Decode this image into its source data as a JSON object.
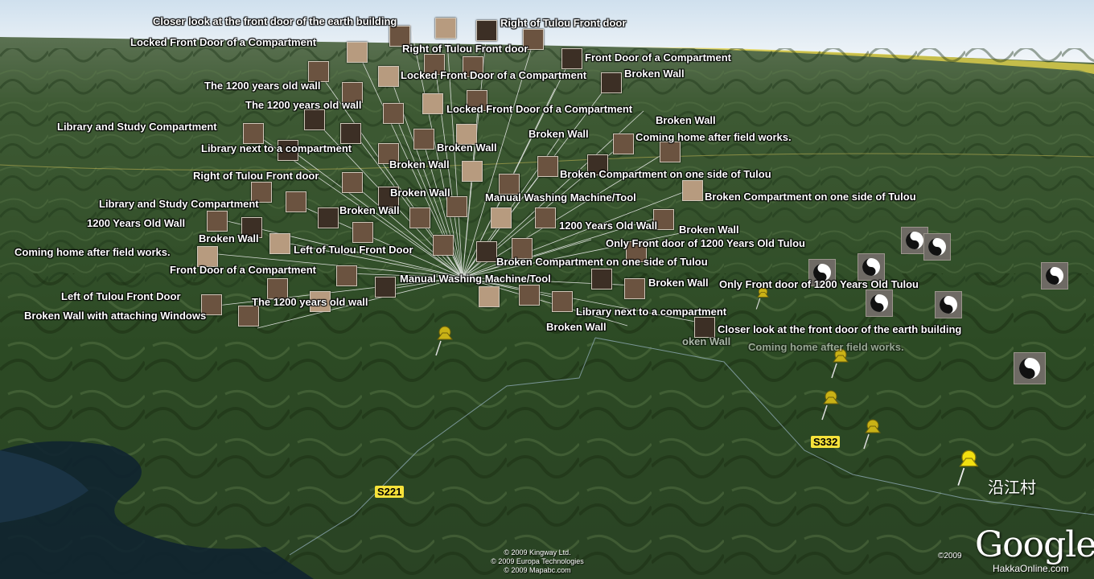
{
  "map": {
    "village_label": "沿江村",
    "roads": [
      "S221",
      "S332"
    ],
    "copyright": [
      "© 2009 Kingway Ltd.",
      "© 2009 Europa Technologies",
      "© 2009 Mapabc.com"
    ],
    "logo": "Google",
    "logo_year": "©2009",
    "watermark": "HakkaOnline.com"
  },
  "placemark_labels": [
    "Closer look at the front door of the earth building",
    "Right of Tulou Front door",
    "Locked Front Door of a Compartment",
    "Right of Tulou Front door",
    "Front Door of a Compartment",
    "Locked Front Door of a Compartment",
    "Broken Wall",
    "The 1200 years old wall",
    "The 1200 years old wall",
    "Locked Front Door of a Compartment",
    "Broken Wall",
    "Library and Study Compartment",
    "Broken Wall",
    "Coming home after field works.",
    "Library next to a compartment",
    "Broken Wall",
    "Right of Tulou Front door",
    "Broken Wall",
    "Broken Compartment on one side of Tulou",
    "Broken Wall",
    "Manual Washing Machine/Tool",
    "Broken Compartment on one side of Tulou",
    "Library and Study Compartment",
    "Broken Wall",
    "1200 Years Old Wall",
    "1200 Years Old Wall",
    "Broken Wall",
    "Broken Wall",
    "Only Front door of 1200 Years Old Tulou",
    "Left of Tulou Front Door",
    "Coming home after field works.",
    "Broken Compartment on one side of Tulou",
    "Front Door of a Compartment",
    "Manual Washing Machine/Tool",
    "Broken Wall",
    "Only Front door of 1200 Years Old Tulou",
    "Left of Tulou Front Door",
    "The 1200 years old wall",
    "Library next to a compartment",
    "Broken Wall with attaching Windows",
    "Broken Wall",
    "Closer look at the front door of the earth building",
    "oken Wall",
    "Coming home after field works."
  ],
  "colors": {
    "sky": "#dfeaf3",
    "terrain": "#2f4a28",
    "pin": "#c9b216",
    "pin_bright": "#f2e010",
    "road_shield": "#f6e23a"
  }
}
